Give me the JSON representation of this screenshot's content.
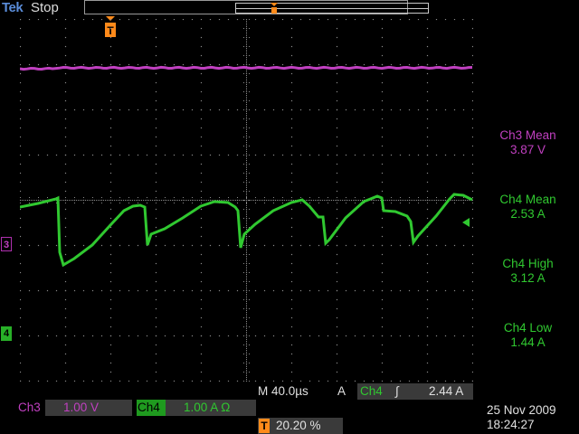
{
  "top_bar": {
    "brand": "Tek",
    "run_status": "Stop"
  },
  "channels": {
    "ch3": {
      "label": "Ch3",
      "scale": "1.00 V",
      "marker": "3",
      "color": "#c040c0"
    },
    "ch4": {
      "label": "Ch4",
      "scale": "1.00 A Ω",
      "marker": "4",
      "color": "#30c830"
    }
  },
  "horizontal": {
    "timebase": "M 40.0µs",
    "trigger_source_tag": "A",
    "trigger_source": "Ch4",
    "trigger_slope": "∫",
    "trigger_level": "2.44 A",
    "trigger_position_icon": "T",
    "trigger_position": "20.20 %"
  },
  "measurements": [
    {
      "label": "Ch3 Mean",
      "value": "3.87 V",
      "channel": "ch3"
    },
    {
      "label": "Ch4 Mean",
      "value": "2.53 A",
      "channel": "ch4"
    },
    {
      "label": "Ch4 High",
      "value": "3.12 A",
      "channel": "ch4"
    },
    {
      "label": "Ch4 Low",
      "value": "1.44 A",
      "channel": "ch4"
    }
  ],
  "datetime": {
    "date": "25 Nov 2009",
    "time": "18:24:27"
  },
  "colors": {
    "trigger": "#ff8a1a",
    "graticule": "#8a8a8a"
  },
  "icons": [
    "trigger-marker-icon",
    "trigger-level-arrow-icon",
    "ch3-ground-marker-icon",
    "ch4-ground-marker-icon"
  ]
}
